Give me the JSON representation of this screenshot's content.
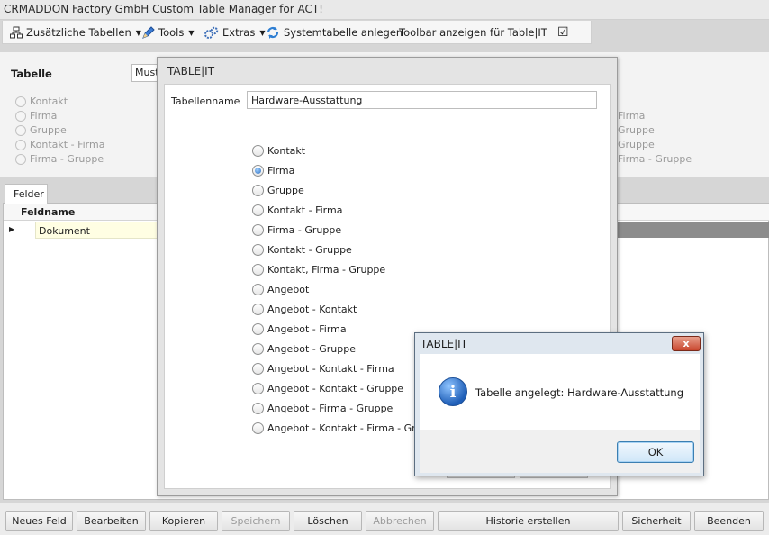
{
  "app": {
    "title": "CRMADDON Factory GmbH Custom Table Manager for ACT!"
  },
  "toolbar": {
    "items": [
      {
        "label": "Zusätzliche Tabellen",
        "icon": "table-tree-icon",
        "dropdown": true
      },
      {
        "label": "Tools",
        "icon": "pencil-icon",
        "dropdown": true
      },
      {
        "label": "Extras",
        "icon": "gears-icon",
        "dropdown": true
      },
      {
        "label": "Systemtabelle anlegen",
        "icon": "refresh-icon",
        "dropdown": false
      },
      {
        "label": "Toolbar anzeigen für Table|IT",
        "icon": "",
        "dropdown": false
      }
    ],
    "toolbar_checked": true
  },
  "main": {
    "tabelle_label": "Tabelle",
    "tabelle_value": "Muste",
    "left_options": [
      "Kontakt",
      "Firma",
      "Gruppe",
      "Kontakt - Firma",
      "Firma - Gruppe"
    ],
    "right_options": [
      "Firma",
      "Gruppe",
      "Gruppe",
      "Firma - Gruppe"
    ],
    "tab_label": "Felder",
    "grid": {
      "column_header": "Feldname",
      "rows": [
        "Dokument"
      ]
    }
  },
  "bottom_buttons": [
    {
      "label": "Neues Feld",
      "enabled": true
    },
    {
      "label": "Bearbeiten",
      "enabled": true
    },
    {
      "label": "Kopieren",
      "enabled": true
    },
    {
      "label": "Speichern",
      "enabled": false
    },
    {
      "label": "Löschen",
      "enabled": true
    },
    {
      "label": "Abbrechen",
      "enabled": false
    },
    {
      "label": "Historie erstellen",
      "enabled": true
    },
    {
      "label": "Sicherheit",
      "enabled": true
    },
    {
      "label": "Beenden",
      "enabled": true
    }
  ],
  "dialog": {
    "title": "TABLE|IT",
    "tabellenname_label": "Tabellenname",
    "tabellenname_value": "Hardware-Ausstattung",
    "options": [
      "Kontakt",
      "Firma",
      "Gruppe",
      "Kontakt - Firma",
      "Firma - Gruppe",
      "Kontakt - Gruppe",
      "Kontakt, Firma - Gruppe",
      "Angebot",
      "Angebot - Kontakt",
      "Angebot - Firma",
      "Angebot - Gruppe",
      "Angebot - Kontakt - Firma",
      "Angebot - Kontakt - Gruppe",
      "Angebot - Firma - Gruppe",
      "Angebot - Kontakt - Firma - Gruppe"
    ],
    "selected_option": "Firma"
  },
  "message_box": {
    "title": "TABLE|IT",
    "close_label": "x",
    "message": "Tabelle angelegt: Hardware-Ausstattung",
    "icon": "info-icon",
    "ok_label": "OK"
  }
}
